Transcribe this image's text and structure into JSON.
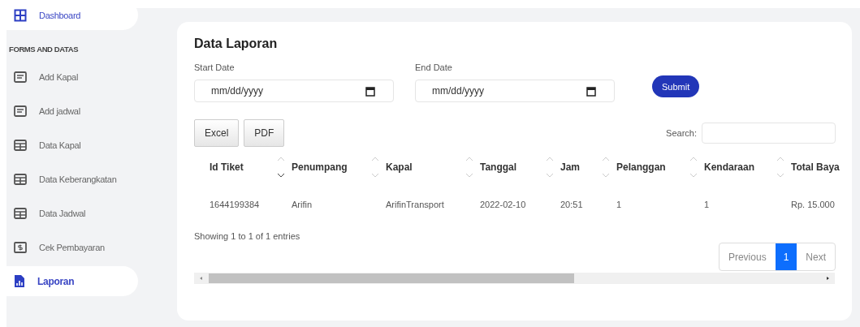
{
  "sidebar": {
    "items": [
      {
        "kind": "grid",
        "label": "Dashboard",
        "selected": true
      },
      {
        "kind": "heading",
        "label": "FORMS AND DATAS"
      },
      {
        "kind": "form",
        "label": "Add Kapal",
        "selected": false
      },
      {
        "kind": "form",
        "label": "Add jadwal",
        "selected": false
      },
      {
        "kind": "table",
        "label": "Data Kapal",
        "selected": false
      },
      {
        "kind": "table",
        "label": "Data Keberangkatan",
        "selected": false
      },
      {
        "kind": "table",
        "label": "Data Jadwal",
        "selected": false
      },
      {
        "kind": "dollar",
        "label": "Cek Pembayaran",
        "selected": false
      },
      {
        "kind": "report",
        "label": "Laporan",
        "selected": true
      }
    ]
  },
  "card": {
    "title": "Data Laporan",
    "start_date": {
      "label": "Start Date",
      "placeholder": "mm/dd/yyyy"
    },
    "end_date": {
      "label": "End Date",
      "placeholder": "mm/dd/yyyy"
    },
    "submit": "Submit",
    "export_buttons": [
      "Excel",
      "PDF"
    ],
    "search_label": "Search:",
    "table": {
      "columns": [
        {
          "label": "Id Tiket",
          "sorted_desc": true
        },
        {
          "label": "Penumpang",
          "sorted_desc": false
        },
        {
          "label": "Kapal",
          "sorted_desc": false
        },
        {
          "label": "Tanggal",
          "sorted_desc": false
        },
        {
          "label": "Jam",
          "sorted_desc": false
        },
        {
          "label": "Pelanggan",
          "sorted_desc": false
        },
        {
          "label": "Kendaraan",
          "sorted_desc": false
        },
        {
          "label": "Total Baya"
        }
      ],
      "rows": [
        [
          "1644199384",
          "Arifin",
          "ArifinTransport",
          "2022-02-10",
          "20:51",
          "1",
          "1",
          "Rp. 15.000"
        ]
      ]
    },
    "info": "Showing 1 to 1 of 1 entries",
    "pagination": [
      {
        "label": "Previous",
        "selected": false
      },
      {
        "label": "1",
        "selected": true
      },
      {
        "label": "Next",
        "selected": false
      }
    ]
  }
}
